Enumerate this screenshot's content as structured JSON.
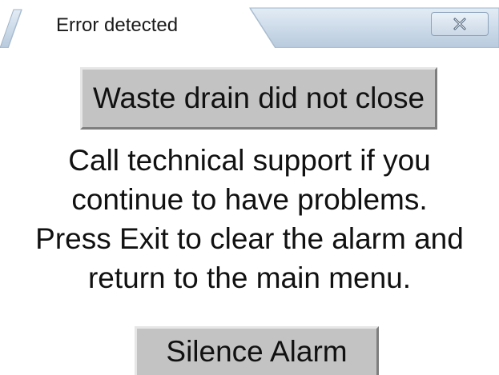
{
  "window": {
    "title": "Error detected",
    "close_icon": "close-x-icon"
  },
  "error": {
    "message": "Waste drain did not close"
  },
  "instructions": {
    "lines": [
      "Call technical support if you",
      "continue to have problems.",
      "Press Exit to clear the alarm and",
      "return to the main menu."
    ]
  },
  "actions": {
    "silence_label": "Silence Alarm"
  },
  "colors": {
    "tab_bar": "#c9d9e8",
    "panel": "#c3c3c3",
    "text": "#111111"
  }
}
